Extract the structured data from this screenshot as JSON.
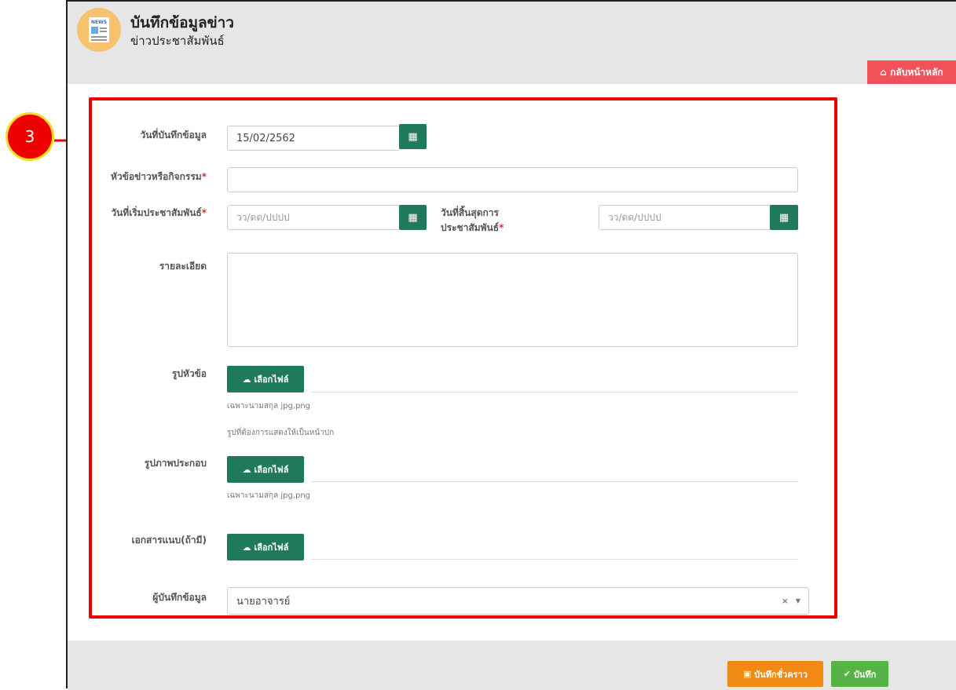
{
  "header": {
    "title": "บันทึกข้อมูลข่าว",
    "subtitle": "ข่าวประชาสัมพันธ์",
    "icon": "newspaper-icon",
    "icon_text": "NEWS"
  },
  "home_button": {
    "label": "กลับหน้าหลัก",
    "icon": "home-icon",
    "color": "#f0525a"
  },
  "step_badge": {
    "number": "3",
    "color": "#ee0000"
  },
  "form": {
    "record_date": {
      "label": "วันที่บันทึกข้อมูล",
      "value": "15/02/2562"
    },
    "headline": {
      "label": "หัวข้อข่าวหรือกิจกรรม",
      "required_mark": "*",
      "value": ""
    },
    "pr_start_date": {
      "label": "วันที่เริ่มประชาสัมพันธ์",
      "required_mark": "*",
      "placeholder": "วว/ดด/ปปปป"
    },
    "pr_end_date": {
      "label_line1": "วันที่สิ้นสุดการ",
      "label_line2": "ประชาสัมพันธ์",
      "required_mark": "*",
      "placeholder": "วว/ดด/ปปปป"
    },
    "detail": {
      "label": "รายละเอียด",
      "value": ""
    },
    "cover_image": {
      "label": "รูปหัวข้อ",
      "button_label": "เลือกไฟล์",
      "hint1": "เฉพาะนามสกุล jpg,png",
      "hint2": "รูปที่ต้องการแสดงให้เป็นหน้าปก"
    },
    "illustration": {
      "label": "รูปภาพประกอบ",
      "button_label": "เลือกไฟล์",
      "hint1": "เฉพาะนามสกุล jpg,png"
    },
    "attachment": {
      "label": "เอกสารแนบ(ถ้ามี)",
      "button_label": "เลือกไฟล์"
    },
    "recorder": {
      "label": "ผู้บันทึกข้อมูล",
      "value": "นายอาจารย์",
      "clear": "×",
      "caret": "▼"
    }
  },
  "footer": {
    "draft_label": "บันทึกชั่วคราว",
    "save_label": "บันทึก",
    "draft_color": "#f08a13",
    "save_color": "#58b346"
  }
}
